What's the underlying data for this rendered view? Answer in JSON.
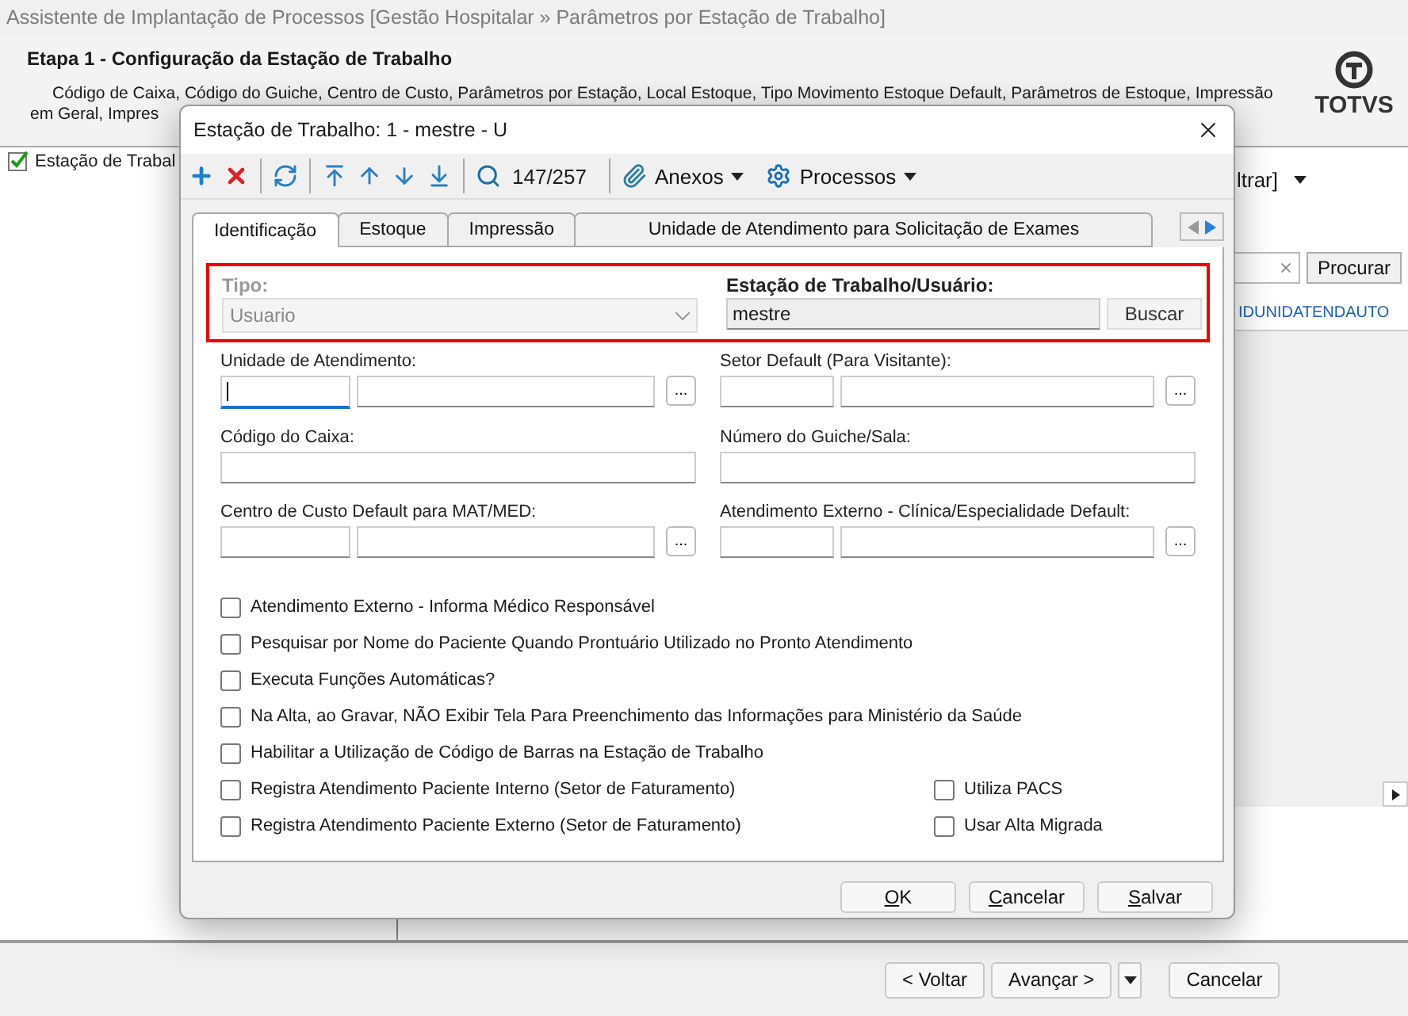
{
  "window": {
    "title": "Assistente de Implantação de Processos [Gestão Hospitalar » Parâmetros por Estação de Trabalho]"
  },
  "step": {
    "title": "Etapa 1 - Configuração da Estação de Trabalho",
    "description_lines": [
      "Código de Caixa, Código do Guiche, Centro de Custo, Parâmetros por Estação, Local Estoque, Tipo Movimento Estoque Default, Parâmetros de Estoque, Impressão",
      "em Geral, Impres"
    ]
  },
  "logo": {
    "text": "TOTVS"
  },
  "tree": {
    "items": [
      {
        "label": "Estação de Trabal",
        "checked": true
      }
    ]
  },
  "grid_panel": {
    "filter_label": "ltrar]",
    "search_button": "Procurar",
    "columns": [
      "IDUNIDATENDAUTO"
    ]
  },
  "wizard_buttons": [
    {
      "kind": "button",
      "label": "< Voltar"
    },
    {
      "kind": "button",
      "label": "Avançar >"
    },
    {
      "kind": "dropdown"
    },
    {
      "kind": "button",
      "label": "Cancelar"
    }
  ],
  "dialog": {
    "title": "Estação de Trabalho: 1 - mestre - U",
    "toolbar": [
      {
        "kind": "icon"
      },
      {
        "kind": "icon"
      },
      {
        "kind": "separator"
      },
      {
        "kind": "icon"
      },
      {
        "kind": "separator"
      },
      {
        "kind": "icon"
      },
      {
        "kind": "icon"
      },
      {
        "kind": "icon"
      },
      {
        "kind": "icon"
      },
      {
        "kind": "separator"
      },
      {
        "kind": "icon"
      },
      {
        "kind": "counter",
        "text": "147/257"
      },
      {
        "kind": "separator"
      },
      {
        "kind": "menu",
        "label": "Anexos"
      },
      {
        "kind": "menu",
        "label": "Processos"
      }
    ],
    "tabs": [
      {
        "label": "Identificação",
        "selected": true
      },
      {
        "label": "Estoque",
        "selected": false
      },
      {
        "label": "Impressão",
        "selected": false
      },
      {
        "label": "Unidade de Atendimento para Solicitação de Exames",
        "selected": false
      }
    ],
    "tab_nav": [
      {
        "kind": "left",
        "disabled": true
      },
      {
        "kind": "right",
        "disabled": false
      }
    ],
    "highlight": {
      "tipo": {
        "label": "Tipo:",
        "value": "Usuario",
        "disabled": true
      },
      "station": {
        "label": "Estação de Trabalho/Usuário:",
        "value": "mestre",
        "button": "Buscar"
      }
    },
    "fields": [
      {
        "kind": "lookup",
        "label": "Unidade de Atendimento:",
        "focused": true,
        "button": "..."
      },
      {
        "kind": "lookup",
        "label": "Setor Default (Para Visitante):",
        "focused": false,
        "button": "..."
      },
      {
        "kind": "text",
        "label": "Código do Caixa:",
        "focused": false
      },
      {
        "kind": "text",
        "label": "Número do Guiche/Sala:",
        "focused": false
      },
      {
        "kind": "lookup",
        "label": "Centro de Custo Default para MAT/MED:",
        "focused": false,
        "button": "..."
      },
      {
        "kind": "lookup",
        "label": "Atendimento Externo - Clínica/Especialidade Default:",
        "focused": false,
        "button": "..."
      }
    ],
    "options_left": [
      {
        "label": "Atendimento Externo - Informa Médico Responsável",
        "checked": false
      },
      {
        "label": "Pesquisar por Nome do Paciente Quando Prontuário Utilizado no Pronto Atendimento",
        "checked": false
      },
      {
        "label": "Executa Funções Automáticas?",
        "checked": false
      },
      {
        "label": "Na Alta, ao Gravar, NÃO Exibir Tela Para Preenchimento das Informações para Ministério da Saúde",
        "checked": false
      },
      {
        "label": "Habilitar a Utilização de Código de Barras na Estação de Trabalho",
        "checked": false
      },
      {
        "label": "Registra Atendimento Paciente Interno (Setor de Faturamento)",
        "checked": false
      },
      {
        "label": "Registra Atendimento Paciente Externo (Setor de Faturamento)",
        "checked": false
      }
    ],
    "options_right": [
      {
        "label": "Utiliza PACS",
        "checked": false
      },
      {
        "label": "Usar Alta Migrada",
        "checked": false
      }
    ],
    "buttons": [
      {
        "label": "OK",
        "mnemonic": true
      },
      {
        "label": "Cancelar",
        "mnemonic": true
      },
      {
        "label": "Salvar",
        "mnemonic": true
      }
    ]
  }
}
